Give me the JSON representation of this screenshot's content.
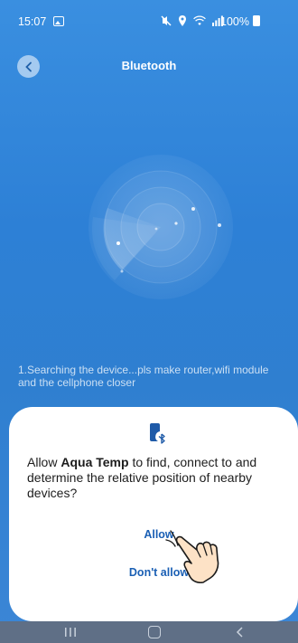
{
  "status_bar": {
    "time": "15:07",
    "battery": "100%",
    "icons": [
      "image-icon",
      "mute-icon",
      "location-icon",
      "wifi-icon",
      "signal-icon",
      "battery-icon"
    ]
  },
  "header": {
    "title": "Bluetooth",
    "back_icon": "chevron-left-icon"
  },
  "main": {
    "search_hint": "1.Searching the device...pls make router,wifi module and the cellphone closer"
  },
  "dialog": {
    "icon": "bluetooth-device-icon",
    "message_prefix": "Allow ",
    "app_name": "Aqua Temp",
    "message_suffix": " to find, connect to and determine the relative position of nearby devices?",
    "allow_label": "Allow",
    "deny_label": "Don't allow"
  },
  "nav_bar": {
    "icons": [
      "recent-apps-icon",
      "home-icon",
      "back-icon"
    ]
  },
  "colors": {
    "background": "#2f7fd0",
    "accent": "#1a5fb4",
    "dialog": "#ffffff",
    "nav_bar": "#5f6f86"
  }
}
